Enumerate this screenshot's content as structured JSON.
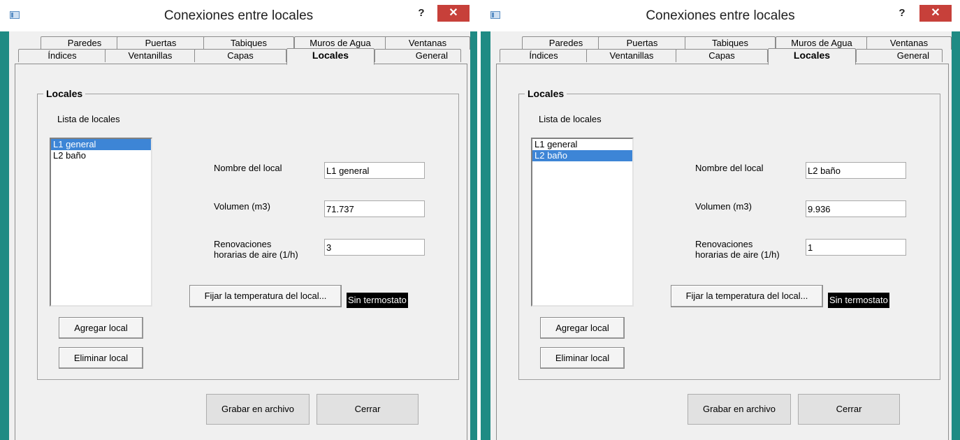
{
  "windows": [
    {
      "title": "Conexiones entre locales",
      "help_label": "?",
      "close_label": "✕",
      "tabs_row1": [
        "Paredes",
        "Puertas",
        "Tabiques",
        "Muros de Agua",
        "Ventanas"
      ],
      "tabs_row2": [
        "Índices",
        "Ventanillas",
        "Capas",
        "Locales",
        "General"
      ],
      "active_tab": "Locales",
      "group_title": "Locales",
      "list_label": "Lista de locales",
      "list_items": [
        "L1 general",
        "L2 baño"
      ],
      "selected_index": 0,
      "name_label": "Nombre del local",
      "name_value": "L1 general",
      "volume_label": "Volumen (m3)",
      "volume_value": "71.737",
      "renov_label_line1": "Renovaciones",
      "renov_label_line2": "horarias de aire (1/h)",
      "renov_value": "3",
      "set_temp_button": "Fijar la temperatura del local...",
      "thermostat_status": "Sin termostato",
      "add_button": "Agregar local",
      "delete_button": "Eliminar local",
      "save_button": "Grabar en archivo",
      "close_button": "Cerrar"
    },
    {
      "title": "Conexiones entre locales",
      "help_label": "?",
      "close_label": "✕",
      "tabs_row1": [
        "Paredes",
        "Puertas",
        "Tabiques",
        "Muros de Agua",
        "Ventanas"
      ],
      "tabs_row2": [
        "Índices",
        "Ventanillas",
        "Capas",
        "Locales",
        "General"
      ],
      "active_tab": "Locales",
      "group_title": "Locales",
      "list_label": "Lista de locales",
      "list_items": [
        "L1 general",
        "L2 baño"
      ],
      "selected_index": 1,
      "name_label": "Nombre del local",
      "name_value": "L2 baño",
      "volume_label": "Volumen (m3)",
      "volume_value": "9.936",
      "renov_label_line1": "Renovaciones",
      "renov_label_line2": "horarias de aire (1/h)",
      "renov_value": "1",
      "set_temp_button": "Fijar la temperatura del local...",
      "thermostat_status": "Sin termostato",
      "add_button": "Agregar local",
      "delete_button": "Eliminar local",
      "save_button": "Grabar en archivo",
      "close_button": "Cerrar"
    }
  ],
  "colors": {
    "close_button": "#c7403a",
    "frame": "#1f8b84",
    "selection": "#3d85d6",
    "dialog_bg": "#f0f0f0"
  }
}
